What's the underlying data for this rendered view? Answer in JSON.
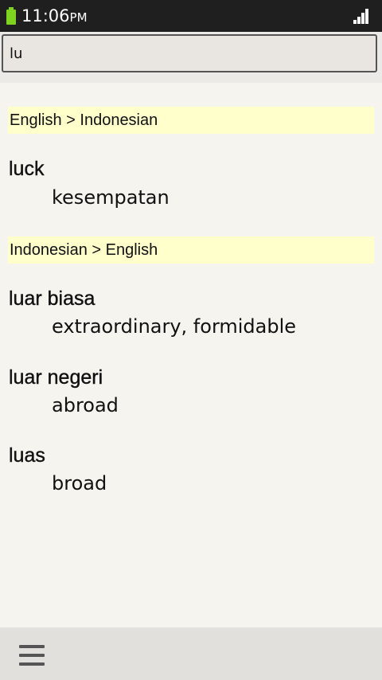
{
  "status_bar": {
    "time": "11:06",
    "ampm": "PM",
    "battery_color": "#7ed321"
  },
  "search": {
    "value": "lu",
    "placeholder": ""
  },
  "sections": [
    {
      "header": "English > Indonesian",
      "entries": [
        {
          "word": "luck",
          "definition": "kesempatan"
        }
      ]
    },
    {
      "header": "Indonesian > English",
      "entries": [
        {
          "word": "luar biasa",
          "definition": "extraordinary, formidable"
        },
        {
          "word": "luar negeri",
          "definition": "abroad"
        },
        {
          "word": "luas",
          "definition": "broad"
        }
      ]
    }
  ],
  "bottom_bar": {
    "menu_icon": "hamburger-menu-icon"
  },
  "colors": {
    "header_highlight": "#ffffcc",
    "background": "#f6f4ef"
  }
}
